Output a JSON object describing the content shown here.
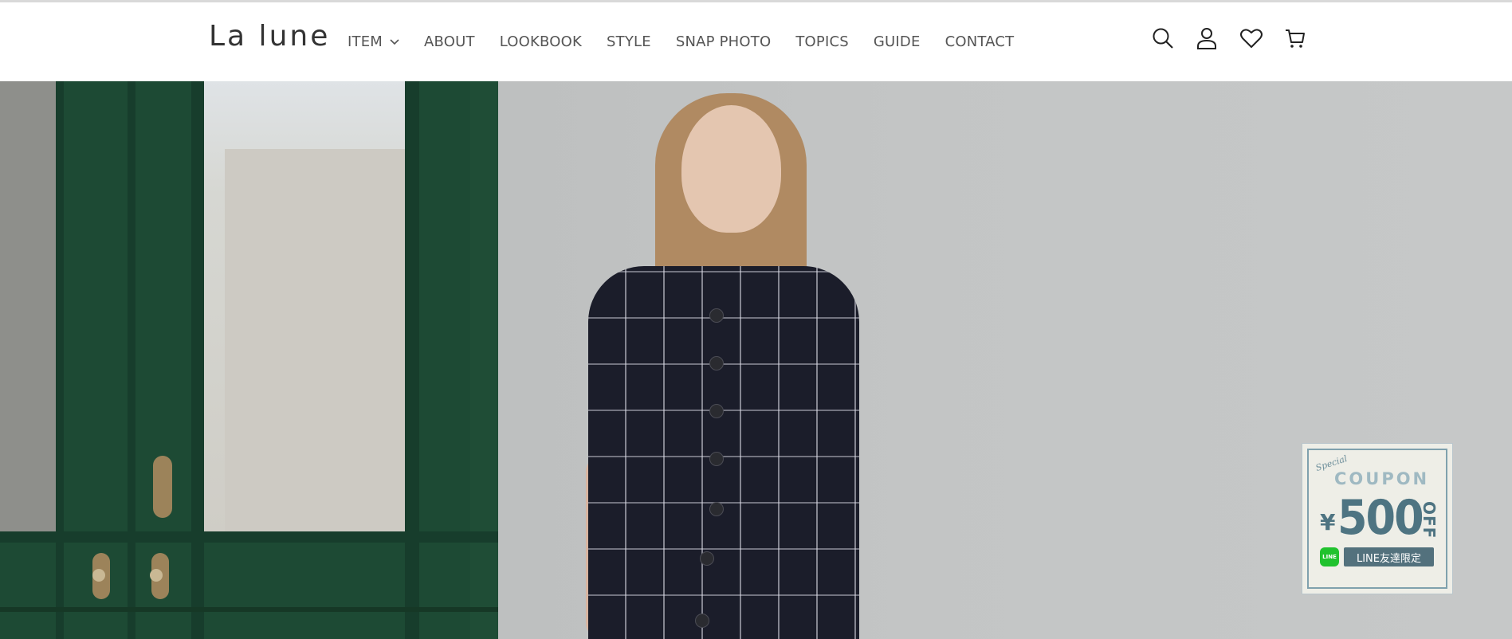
{
  "header": {
    "logo": "La lune",
    "nav": [
      {
        "label": "ITEM",
        "has_dropdown": true
      },
      {
        "label": "ABOUT"
      },
      {
        "label": "LOOKBOOK"
      },
      {
        "label": "STYLE"
      },
      {
        "label": "SNAP PHOTO"
      },
      {
        "label": "TOPICS"
      },
      {
        "label": "GUIDE"
      },
      {
        "label": "CONTACT"
      }
    ],
    "icons": [
      "search-icon",
      "account-icon",
      "wishlist-heart-icon",
      "cart-icon"
    ]
  },
  "coupon": {
    "special": "Special",
    "title": "COUPON",
    "currency": "¥",
    "amount": "500",
    "off": "OFF",
    "line_icon": "LINE",
    "line_label": "LINE友達限定"
  },
  "colors": {
    "text": "#555555",
    "door_green": "#1d4a34",
    "coupon_accent": "#4e7482",
    "line_green": "#20c22e"
  }
}
